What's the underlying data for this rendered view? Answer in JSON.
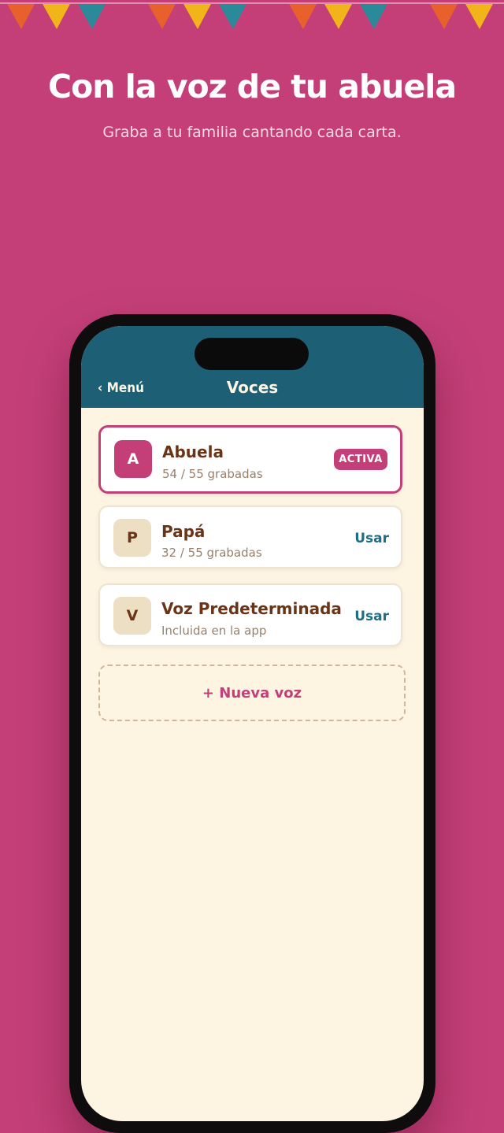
{
  "promo": {
    "headline": "Con la voz de tu abuela",
    "subhead": "Graba a tu familia cantando cada carta."
  },
  "colors": {
    "background": "#c43f78",
    "navbar": "#1d5f74",
    "screen": "#fdf4e2",
    "accent": "#c43f78",
    "text_brown": "#6b3417",
    "link_teal": "#1d6f86",
    "bunting": [
      "#e8602c",
      "#f2b41b",
      "#2a8a9a"
    ]
  },
  "nav": {
    "back_label": "‹ Menú",
    "title": "Voces"
  },
  "voices": [
    {
      "initial": "A",
      "name": "Abuela",
      "subtitle": "54 / 55 grabadas",
      "status": "ACTIVA"
    },
    {
      "initial": "P",
      "name": "Papá",
      "subtitle": "32 / 55 grabadas",
      "action": "Usar"
    },
    {
      "initial": "V",
      "name": "Voz Predeterminada",
      "subtitle": "Incluida en la app",
      "action": "Usar"
    }
  ],
  "new_voice_label": "+ Nueva voz"
}
